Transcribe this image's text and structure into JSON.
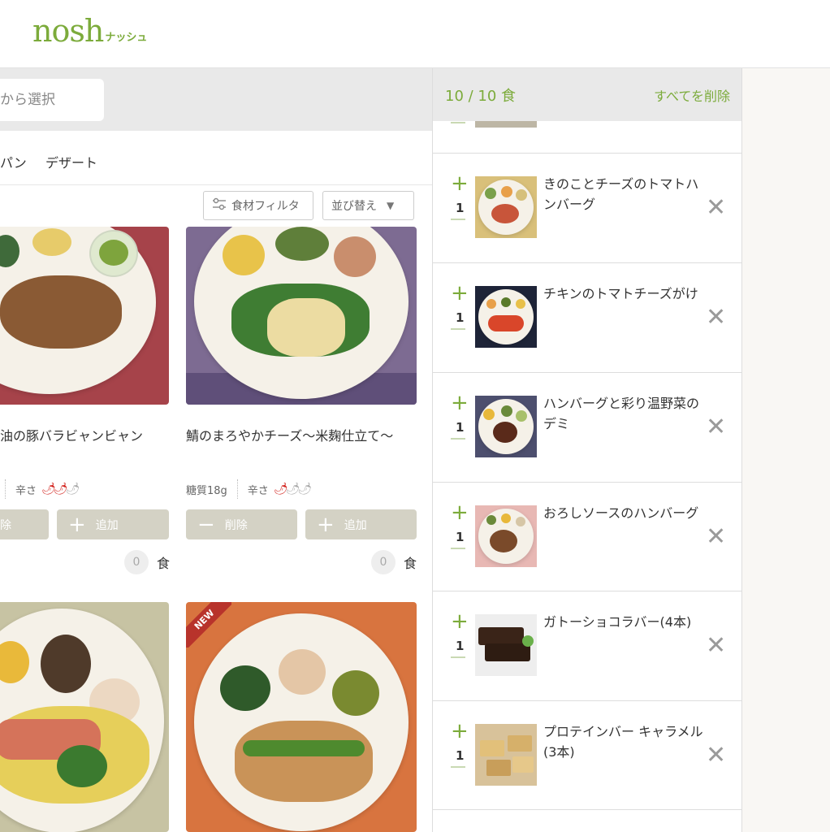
{
  "header": {
    "logo": "nosh",
    "logo_kana": "ナッシュ"
  },
  "search": {
    "placeholder": "から選択"
  },
  "categories": [
    "パン",
    "デザート"
  ],
  "toolbar": {
    "filter_label": "食材フィルタ",
    "sort_label": "並び替え"
  },
  "menu_cards": [
    {
      "title": "油の豚バラビャンビャン",
      "carbs": "",
      "spice_label": "辛さ",
      "spice_level": 2,
      "remove_label": "除",
      "add_label": "追加",
      "count": "0",
      "unit": "食"
    },
    {
      "title": "鯖のまろやかチーズ〜米麹仕立て〜",
      "carbs": "糖質18g",
      "spice_label": "辛さ",
      "spice_level": 1,
      "remove_label": "削除",
      "add_label": "追加",
      "count": "0",
      "unit": "食"
    },
    {
      "title": "",
      "badge": ""
    },
    {
      "title": "",
      "badge": "NEW"
    }
  ],
  "cart": {
    "count_text": "10 / 10 食",
    "clear_label": "すべてを削除",
    "items": [
      {
        "name": "きのことチーズのトマトハンバーグ",
        "qty": "1"
      },
      {
        "name": "チキンのトマトチーズがけ",
        "qty": "1"
      },
      {
        "name": "ハンバーグと彩り温野菜のデミ",
        "qty": "1"
      },
      {
        "name": "おろしソースのハンバーグ",
        "qty": "1"
      },
      {
        "name": "ガトーショコラバー(4本)",
        "qty": "1"
      },
      {
        "name": "プロテインバー キャラメル(3本)",
        "qty": "1"
      }
    ]
  },
  "colors": {
    "brand": "#7cab3b",
    "button_gray": "#d4d2c5",
    "remove_x": "#9a9a9a"
  },
  "icons": [
    "filter-icon",
    "sort-down-icon",
    "chili-pepper-icon",
    "plus-icon",
    "minus-icon",
    "remove-x-icon"
  ]
}
